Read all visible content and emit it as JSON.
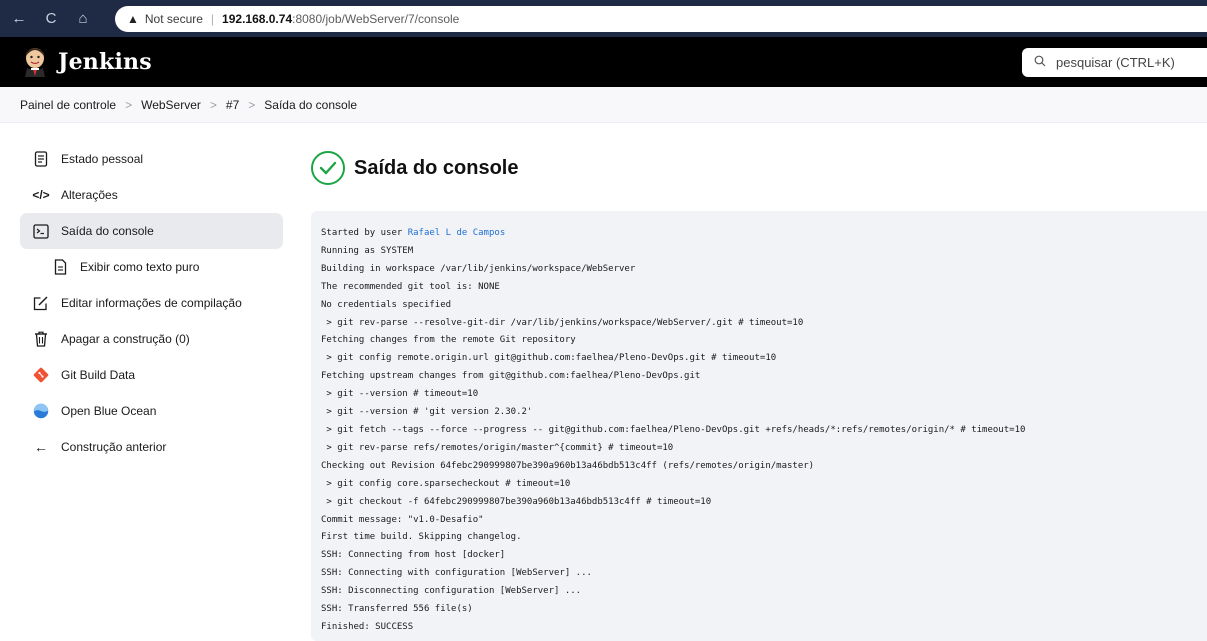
{
  "browser": {
    "back_icon": "←",
    "reload_icon": "C",
    "home_icon": "⌂",
    "warning_icon": "▲",
    "security_label": "Not secure",
    "url_host": "192.168.0.74",
    "url_rest": ":8080/job/WebServer/7/console"
  },
  "header": {
    "brand": "Jenkins",
    "search_placeholder": "pesquisar (CTRL+K)"
  },
  "breadcrumb": {
    "items": [
      "Painel de controle",
      "WebServer",
      "#7",
      "Saída do console"
    ],
    "separator": ">"
  },
  "sidebar": {
    "items": [
      {
        "label": "Estado pessoal",
        "icon": "document-icon",
        "glyph": "▤"
      },
      {
        "label": "Alterações",
        "icon": "code-icon",
        "glyph": "</>"
      },
      {
        "label": "Saída do console",
        "icon": "terminal-icon",
        "glyph": "▣"
      },
      {
        "label": "Exibir como texto puro",
        "icon": "file-text-icon",
        "glyph": "▯"
      },
      {
        "label": "Editar informações de compilação",
        "icon": "edit-icon",
        "glyph": "✎"
      },
      {
        "label": "Apagar a construção (0)",
        "icon": "trash-icon",
        "glyph": "🗑"
      },
      {
        "label": "Git Build Data",
        "icon": "git-icon",
        "glyph": "◆"
      },
      {
        "label": "Open Blue Ocean",
        "icon": "blue-ocean-icon",
        "glyph": "●"
      },
      {
        "label": "Construção anterior",
        "icon": "arrow-left-icon",
        "glyph": "←"
      }
    ]
  },
  "main": {
    "title": "Saída do console",
    "status_icon": "check-circle-icon",
    "console": {
      "started_prefix": "Started by user ",
      "user": "Rafael L de Campos",
      "lines": [
        "Running as SYSTEM",
        "Building in workspace /var/lib/jenkins/workspace/WebServer",
        "The recommended git tool is: NONE",
        "No credentials specified",
        " > git rev-parse --resolve-git-dir /var/lib/jenkins/workspace/WebServer/.git # timeout=10",
        "Fetching changes from the remote Git repository",
        " > git config remote.origin.url git@github.com:faelhea/Pleno-DevOps.git # timeout=10",
        "Fetching upstream changes from git@github.com:faelhea/Pleno-DevOps.git",
        " > git --version # timeout=10",
        " > git --version # 'git version 2.30.2'",
        " > git fetch --tags --force --progress -- git@github.com:faelhea/Pleno-DevOps.git +refs/heads/*:refs/remotes/origin/* # timeout=10",
        " > git rev-parse refs/remotes/origin/master^{commit} # timeout=10",
        "Checking out Revision 64febc290999807be390a960b13a46bdb513c4ff (refs/remotes/origin/master)",
        " > git config core.sparsecheckout # timeout=10",
        " > git checkout -f 64febc290999807be390a960b13a46bdb513c4ff # timeout=10",
        "Commit message: \"v1.0-Desafio\"",
        "First time build. Skipping changelog.",
        "SSH: Connecting from host [docker]",
        "SSH: Connecting with configuration [WebServer] ...",
        "SSH: Disconnecting configuration [WebServer] ...",
        "SSH: Transferred 556 file(s)",
        "Finished: SUCCESS"
      ]
    }
  },
  "colors": {
    "browser_bar": "#1f2b45",
    "header_bg": "#000000",
    "success_green": "#1ea446",
    "link_blue": "#1f6fd1",
    "console_bg": "#f2f3f6"
  }
}
